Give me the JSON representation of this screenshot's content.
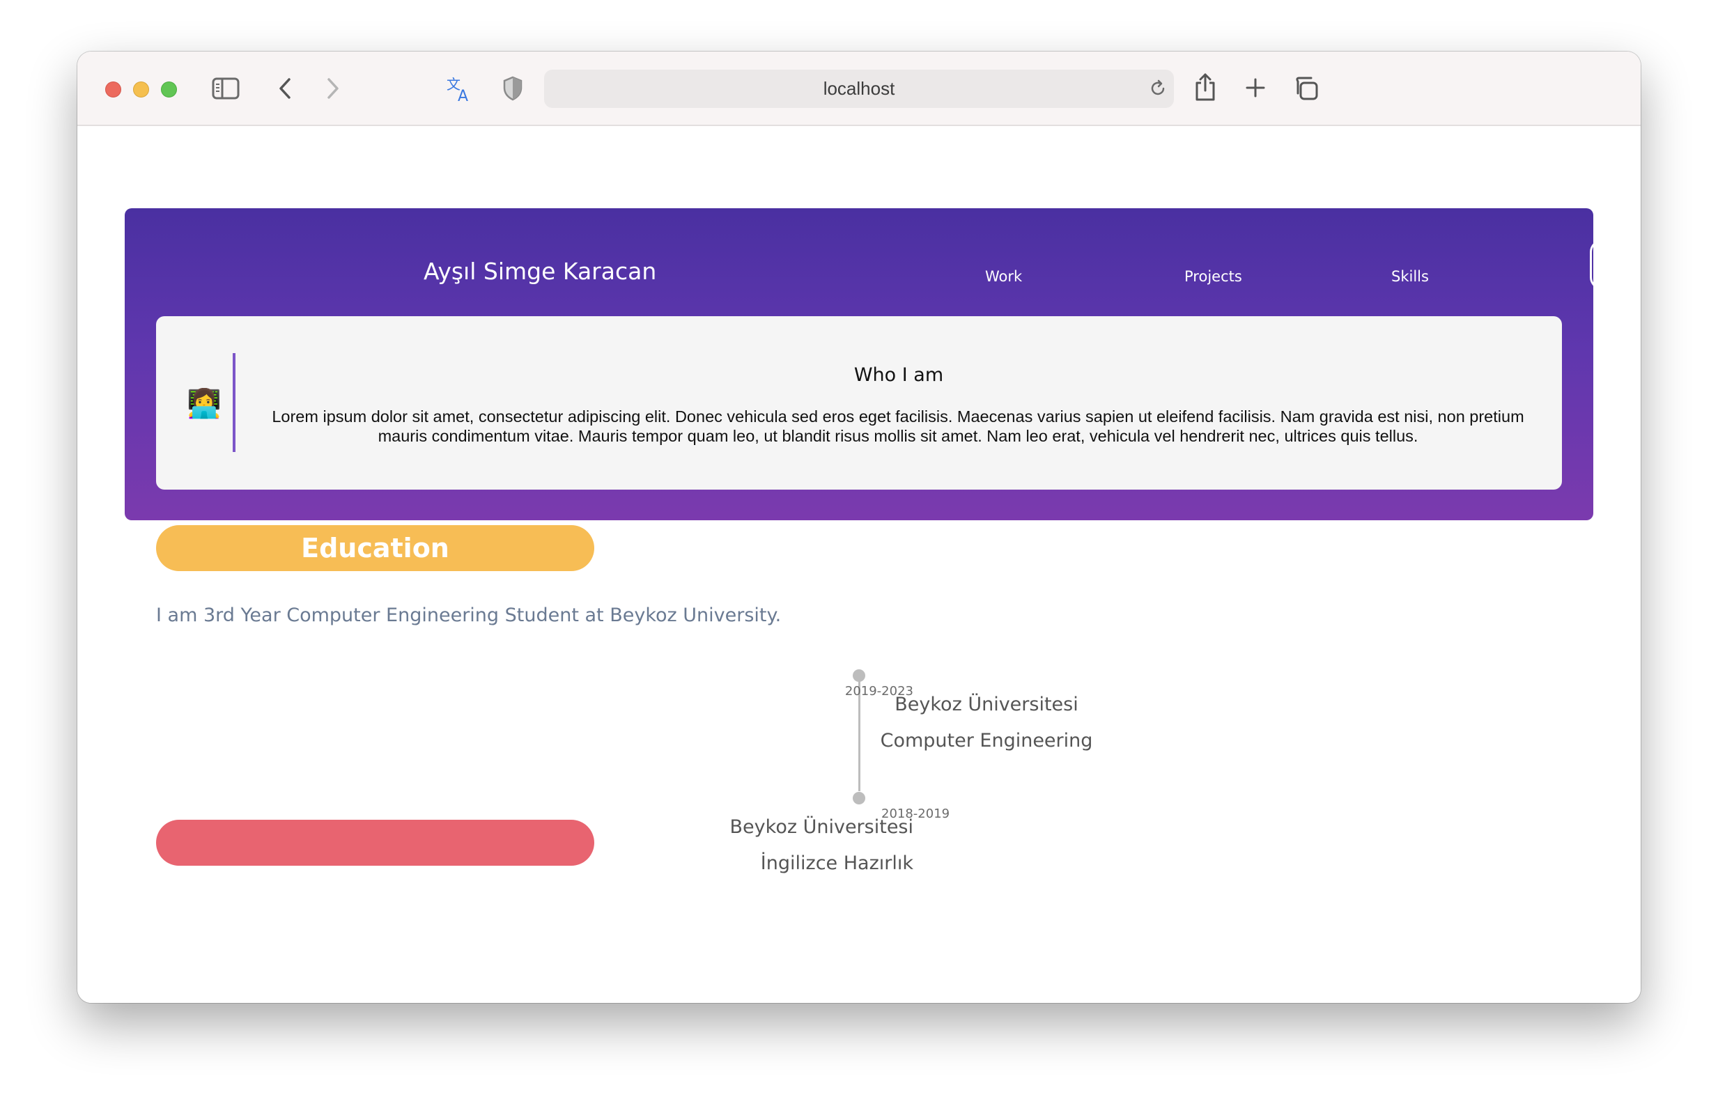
{
  "browser": {
    "url": "localhost",
    "icons": [
      "sidebar-icon",
      "back-icon",
      "forward-icon",
      "translate-icon",
      "shield-icon",
      "reload-icon",
      "share-icon",
      "plus-icon",
      "tabs-icon"
    ]
  },
  "header": {
    "name": "Ayşıl Simge Karacan",
    "nav": {
      "work": "Work",
      "projects": "Projects",
      "skills": "Skills"
    },
    "theme_toggle_icon": "moon-icon"
  },
  "about": {
    "emoji": "👩‍💻",
    "title": "Who I am",
    "text": "Lorem ipsum dolor sit amet, consectetur adipiscing elit. Donec vehicula sed eros eget facilisis. Maecenas varius sapien ut eleifend facilisis. Nam gravida est nisi, non pretium mauris condimentum vitae. Mauris tempor quam leo, ut blandit risus mollis sit amet. Nam leo erat, vehicula vel hendrerit nec, ultrices quis tellus."
  },
  "education": {
    "heading": "Education",
    "intro": "I am 3rd Year Computer Engineering Student at Beykoz University.",
    "timeline": [
      {
        "date": "2019-2023",
        "school": "Beykoz Üniversitesi",
        "program": "Computer Engineering"
      },
      {
        "date": "2018-2019",
        "school": "Beykoz Üniversitesi",
        "program": "İngilizce Hazırlık"
      }
    ]
  },
  "colors": {
    "header_gradient_top": "#4a30a1",
    "header_gradient_bottom": "#7b3aae",
    "education_pill": "#f7bd55",
    "next_section_pill": "#e86470",
    "intro_text": "#6a7a92"
  }
}
